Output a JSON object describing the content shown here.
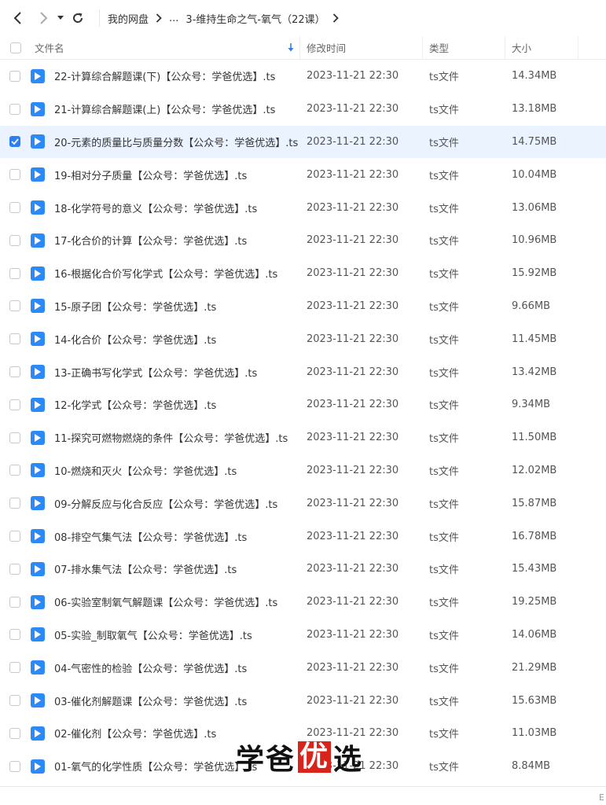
{
  "toolbar": {
    "breadcrumb_root": "我的网盘",
    "breadcrumb_ellipsis": "...",
    "breadcrumb_current": "3-维持生命之气-氧气（22课）"
  },
  "columns": {
    "name": "文件名",
    "modified": "修改时间",
    "type": "类型",
    "size": "大小"
  },
  "files": [
    {
      "name": "22-计算综合解题课(下)【公众号：学爸优选】.ts",
      "modified": "2023-11-21 22:30",
      "type": "ts文件",
      "size": "14.34MB",
      "selected": false
    },
    {
      "name": "21-计算综合解题课(上)【公众号：学爸优选】.ts",
      "modified": "2023-11-21 22:30",
      "type": "ts文件",
      "size": "13.18MB",
      "selected": false
    },
    {
      "name": "20-元素的质量比与质量分数【公众号：学爸优选】.ts",
      "modified": "2023-11-21 22:30",
      "type": "ts文件",
      "size": "14.75MB",
      "selected": true
    },
    {
      "name": "19-相对分子质量【公众号：学爸优选】.ts",
      "modified": "2023-11-21 22:30",
      "type": "ts文件",
      "size": "10.04MB",
      "selected": false
    },
    {
      "name": "18-化学符号的意义【公众号：学爸优选】.ts",
      "modified": "2023-11-21 22:30",
      "type": "ts文件",
      "size": "13.06MB",
      "selected": false
    },
    {
      "name": "17-化合价的计算【公众号：学爸优选】.ts",
      "modified": "2023-11-21 22:30",
      "type": "ts文件",
      "size": "10.96MB",
      "selected": false
    },
    {
      "name": "16-根据化合价写化学式【公众号：学爸优选】.ts",
      "modified": "2023-11-21 22:30",
      "type": "ts文件",
      "size": "15.92MB",
      "selected": false
    },
    {
      "name": "15-原子团【公众号：学爸优选】.ts",
      "modified": "2023-11-21 22:30",
      "type": "ts文件",
      "size": "9.66MB",
      "selected": false
    },
    {
      "name": "14-化合价【公众号：学爸优选】.ts",
      "modified": "2023-11-21 22:30",
      "type": "ts文件",
      "size": "11.45MB",
      "selected": false
    },
    {
      "name": "13-正确书写化学式【公众号：学爸优选】.ts",
      "modified": "2023-11-21 22:30",
      "type": "ts文件",
      "size": "13.42MB",
      "selected": false
    },
    {
      "name": "12-化学式【公众号：学爸优选】.ts",
      "modified": "2023-11-21 22:30",
      "type": "ts文件",
      "size": "9.34MB",
      "selected": false
    },
    {
      "name": "11-探究可燃物燃烧的条件【公众号：学爸优选】.ts",
      "modified": "2023-11-21 22:30",
      "type": "ts文件",
      "size": "11.50MB",
      "selected": false
    },
    {
      "name": "10-燃烧和灭火【公众号：学爸优选】.ts",
      "modified": "2023-11-21 22:30",
      "type": "ts文件",
      "size": "12.02MB",
      "selected": false
    },
    {
      "name": "09-分解反应与化合反应【公众号：学爸优选】.ts",
      "modified": "2023-11-21 22:30",
      "type": "ts文件",
      "size": "15.87MB",
      "selected": false
    },
    {
      "name": "08-排空气集气法【公众号：学爸优选】.ts",
      "modified": "2023-11-21 22:30",
      "type": "ts文件",
      "size": "16.78MB",
      "selected": false
    },
    {
      "name": "07-排水集气法【公众号：学爸优选】.ts",
      "modified": "2023-11-21 22:30",
      "type": "ts文件",
      "size": "15.43MB",
      "selected": false
    },
    {
      "name": "06-实验室制氧气解题课【公众号：学爸优选】.ts",
      "modified": "2023-11-21 22:30",
      "type": "ts文件",
      "size": "19.25MB",
      "selected": false
    },
    {
      "name": "05-实验_制取氧气【公众号：学爸优选】.ts",
      "modified": "2023-11-21 22:30",
      "type": "ts文件",
      "size": "14.06MB",
      "selected": false
    },
    {
      "name": "04-气密性的检验【公众号：学爸优选】.ts",
      "modified": "2023-11-21 22:30",
      "type": "ts文件",
      "size": "21.29MB",
      "selected": false
    },
    {
      "name": "03-催化剂解题课【公众号：学爸优选】.ts",
      "modified": "2023-11-21 22:30",
      "type": "ts文件",
      "size": "15.63MB",
      "selected": false
    },
    {
      "name": "02-催化剂【公众号：学爸优选】.ts",
      "modified": "2023-11-21 22:30",
      "type": "ts文件",
      "size": "11.03MB",
      "selected": false
    },
    {
      "name": "01-氧气的化学性质【公众号：学爸优选】.ts",
      "modified": "2023-11-21 22:30",
      "type": "ts文件",
      "size": "8.84MB",
      "selected": false
    }
  ],
  "watermark": {
    "part1": "学爸",
    "part2": "优",
    "part3": "选"
  },
  "corner_text": "E",
  "colors": {
    "accent": "#2b7ff5",
    "file_icon": "#2b8af7",
    "selected_row": "#eaf3ff",
    "watermark_red": "#d9241c"
  },
  "icons": {
    "back": "chevron-left-icon",
    "forward": "chevron-right-icon",
    "dropdown": "caret-down-icon",
    "refresh": "refresh-icon",
    "sort": "sort-down-arrow-icon",
    "file": "video-file-play-icon"
  }
}
